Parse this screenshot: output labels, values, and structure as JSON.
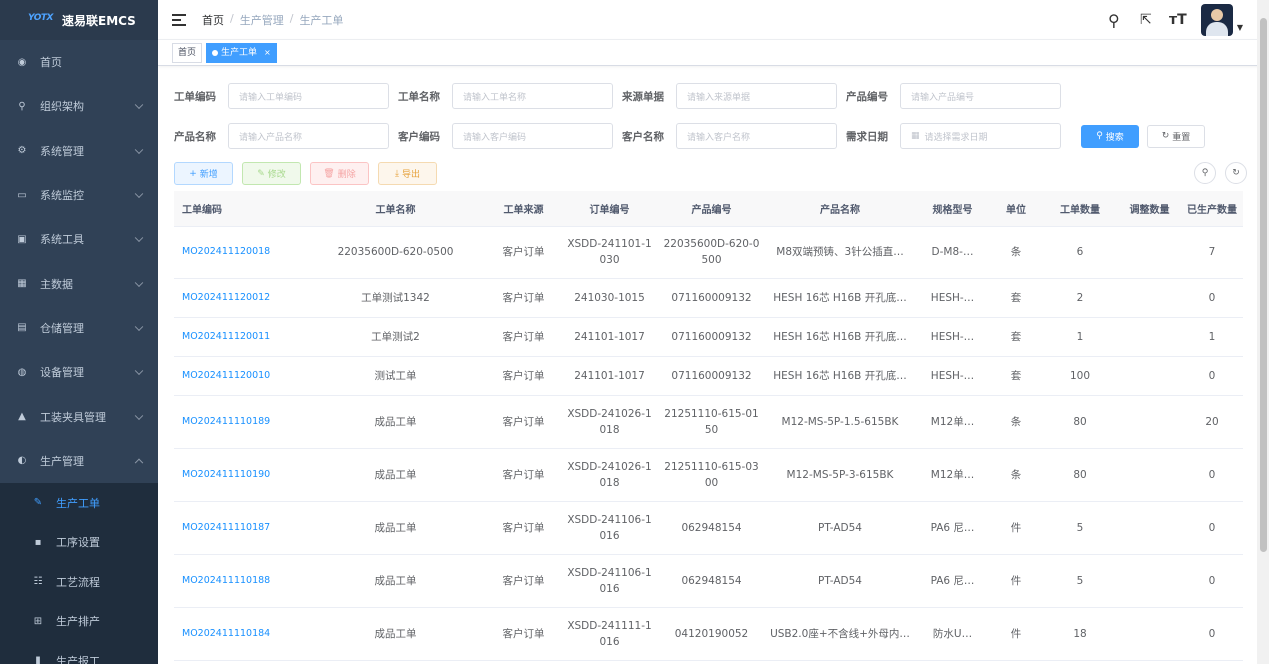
{
  "brand": {
    "logo_mark": "YOTX",
    "name": "速易联EMCS"
  },
  "sidebar": {
    "items": [
      {
        "label": "首页",
        "icon": "dashboard-icon",
        "glyph": "◉"
      },
      {
        "label": "组织架构",
        "icon": "tree-icon",
        "glyph": "⚲"
      },
      {
        "label": "系统管理",
        "icon": "gear-icon",
        "glyph": "⚙"
      },
      {
        "label": "系统监控",
        "icon": "monitor-icon",
        "glyph": "▭"
      },
      {
        "label": "系统工具",
        "icon": "toolbox-icon",
        "glyph": "▣"
      },
      {
        "label": "主数据",
        "icon": "grid-icon",
        "glyph": "▦"
      },
      {
        "label": "仓储管理",
        "icon": "warehouse-icon",
        "glyph": "▤"
      },
      {
        "label": "设备管理",
        "icon": "device-icon",
        "glyph": "◍"
      },
      {
        "label": "工装夹具管理",
        "icon": "lock-icon",
        "glyph": "▲"
      },
      {
        "label": "生产管理",
        "icon": "eye-icon",
        "glyph": "◐"
      }
    ],
    "sub_items": [
      {
        "label": "生产工单",
        "icon": "edit-icon",
        "glyph": "✎"
      },
      {
        "label": "工序设置",
        "icon": "list-icon",
        "glyph": "▪"
      },
      {
        "label": "工艺流程",
        "icon": "tree-list-icon",
        "glyph": "☷"
      },
      {
        "label": "生产排产",
        "icon": "table-icon",
        "glyph": "⊞"
      },
      {
        "label": "生产报工",
        "icon": "bar-chart-icon",
        "glyph": "▮"
      }
    ]
  },
  "breadcrumb": [
    "首页",
    "生产管理",
    "生产工单"
  ],
  "tags": {
    "home": "首页",
    "active": "生产工单"
  },
  "search": {
    "row1": [
      {
        "label": "工单编码",
        "placeholder": "请输入工单编码"
      },
      {
        "label": "工单名称",
        "placeholder": "请输入工单名称"
      },
      {
        "label": "来源单据",
        "placeholder": "请输入来源单据"
      },
      {
        "label": "产品编号",
        "placeholder": "请输入产品编号"
      }
    ],
    "row2": [
      {
        "label": "产品名称",
        "placeholder": "请输入产品名称"
      },
      {
        "label": "客户编码",
        "placeholder": "请输入客户编码"
      },
      {
        "label": "客户名称",
        "placeholder": "请输入客户名称"
      },
      {
        "label": "需求日期",
        "placeholder": "请选择需求日期"
      }
    ],
    "search_label": "搜索",
    "reset_label": "重置"
  },
  "actions": {
    "add": "新增",
    "edit": "修改",
    "delete": "删除",
    "export": "导出"
  },
  "table": {
    "columns": [
      "工单编码",
      "工单名称",
      "工单来源",
      "订单编号",
      "产品编号",
      "产品名称",
      "规格型号",
      "单位",
      "工单数量",
      "调整数量",
      "已生产数量"
    ],
    "rows": [
      {
        "code": "MO202411120018",
        "name": "22035600D-620-0500",
        "source": "客户订单",
        "order": "XSDD-241101-1030",
        "product_no": "22035600D-620-0500",
        "product_name": "M8双端预铸、3针公插直…",
        "spec": "D-M8-…",
        "unit": "条",
        "qty": "6",
        "adj": "",
        "done": "7"
      },
      {
        "code": "MO202411120012",
        "name": "工单测试1342",
        "source": "客户订单",
        "order": "241030-1015",
        "product_no": "071160009132",
        "product_name": "HESH 16芯 H16B 开孔底…",
        "spec": "HESH-…",
        "unit": "套",
        "qty": "2",
        "adj": "",
        "done": "0"
      },
      {
        "code": "MO202411120011",
        "name": "工单测试2",
        "source": "客户订单",
        "order": "241101-1017",
        "product_no": "071160009132",
        "product_name": "HESH 16芯 H16B 开孔底…",
        "spec": "HESH-…",
        "unit": "套",
        "qty": "1",
        "adj": "",
        "done": "1"
      },
      {
        "code": "MO202411120010",
        "name": "测试工单",
        "source": "客户订单",
        "order": "241101-1017",
        "product_no": "071160009132",
        "product_name": "HESH 16芯 H16B 开孔底…",
        "spec": "HESH-…",
        "unit": "套",
        "qty": "100",
        "adj": "",
        "done": "0"
      },
      {
        "code": "MO202411110189",
        "name": "成品工单",
        "source": "客户订单",
        "order": "XSDD-241026-1018",
        "product_no": "21251110-615-0150",
        "product_name": "M12-MS-5P-1.5-615BK",
        "spec": "M12单…",
        "unit": "条",
        "qty": "80",
        "adj": "",
        "done": "20"
      },
      {
        "code": "MO202411110190",
        "name": "成品工单",
        "source": "客户订单",
        "order": "XSDD-241026-1018",
        "product_no": "21251110-615-0300",
        "product_name": "M12-MS-5P-3-615BK",
        "spec": "M12单…",
        "unit": "条",
        "qty": "80",
        "adj": "",
        "done": "0"
      },
      {
        "code": "MO202411110187",
        "name": "成品工单",
        "source": "客户订单",
        "order": "XSDD-241106-1016",
        "product_no": "062948154",
        "product_name": "PT-AD54",
        "spec": "PA6 尼…",
        "unit": "件",
        "qty": "5",
        "adj": "",
        "done": "0"
      },
      {
        "code": "MO202411110188",
        "name": "成品工单",
        "source": "客户订单",
        "order": "XSDD-241106-1016",
        "product_no": "062948154",
        "product_name": "PT-AD54",
        "spec": "PA6 尼…",
        "unit": "件",
        "qty": "5",
        "adj": "",
        "done": "0"
      },
      {
        "code": "MO202411110184",
        "name": "成品工单",
        "source": "客户订单",
        "order": "XSDD-241111-1016",
        "product_no": "04120190052",
        "product_name": "USB2.0座+不含线+外母内…",
        "spec": "防水U…",
        "unit": "件",
        "qty": "18",
        "adj": "",
        "done": "0"
      }
    ]
  },
  "colors": {
    "sidebar_bg": "#304156",
    "accent": "#409eff",
    "link": "#1890ff"
  }
}
